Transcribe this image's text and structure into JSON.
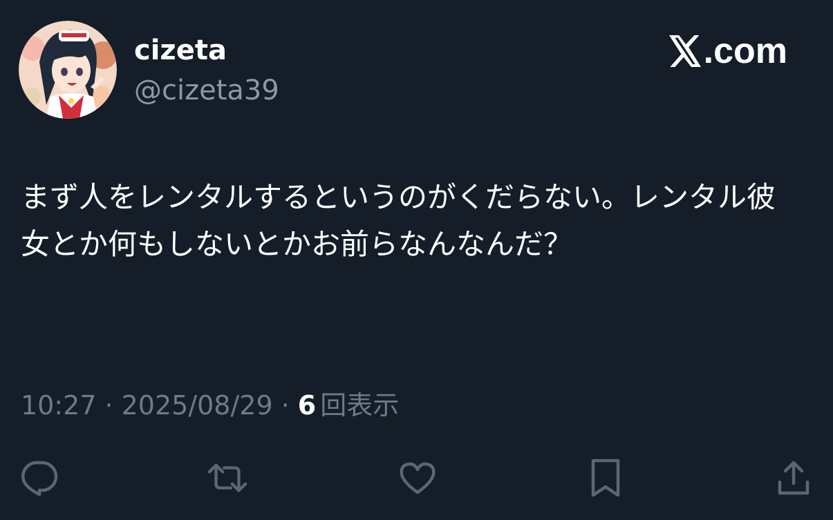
{
  "user": {
    "display_name": "cizeta",
    "handle": "@cizeta39"
  },
  "site": {
    "logo_icon": "x-logo-icon",
    "domain_suffix": ".com"
  },
  "tweet": {
    "text": "まず人をレンタルするというのがくだらない。レンタル彼女とか何もしないとかお前らなんなんだ？",
    "time": "10:27",
    "separator": "·",
    "date": "2025/08/29",
    "views_count": "6",
    "views_label": "回表示"
  },
  "actions": [
    {
      "name": "reply-icon"
    },
    {
      "name": "retweet-icon"
    },
    {
      "name": "like-icon"
    },
    {
      "name": "bookmark-icon"
    },
    {
      "name": "share-icon"
    }
  ],
  "colors": {
    "background": "#151d28",
    "primary_text": "#ffffff",
    "secondary_text": "#8b98a5",
    "icon": "#5b6672"
  }
}
